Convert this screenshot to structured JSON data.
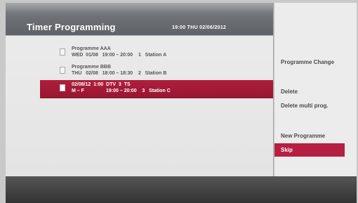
{
  "header": {
    "title": "Timer Programming",
    "datetime": "19:00  THU  02/06/2012"
  },
  "programmes": [
    {
      "line1": "Programme AAA",
      "line2": "WED  01/08   19:00 – 20:00    1   Station A",
      "selected": false
    },
    {
      "line1": "Programme BBB",
      "line2": "THU   02/08   18:00 – 18:30    2   Station B",
      "selected": false
    },
    {
      "line1": "02/08/12  1:00  DTV  3  TS",
      "line2": "M – F                19:00 – 20:00    3   Station C",
      "selected": true
    }
  ],
  "menu": {
    "programme_change": "Programme Change",
    "delete": "Delete",
    "delete_multi": "Delete multi prog.",
    "new_programme": "New Programme",
    "skip": "Skip"
  },
  "colors": {
    "accent": "#b51f42",
    "selected_row": "#a81b38",
    "header": "#6d7075"
  }
}
